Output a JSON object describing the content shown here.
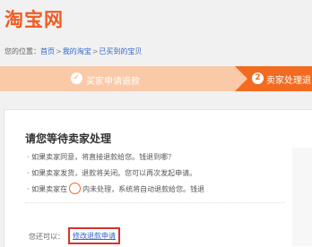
{
  "logo": "淘宝网",
  "breadcrumb": {
    "prefix": "您的位置：",
    "items": [
      "首页",
      "我的淘宝",
      "已买到的宝贝"
    ],
    "sep": ">"
  },
  "steps": {
    "step1_label": "买家申请退款",
    "step2_num": "2",
    "step2_label": "卖家处理退"
  },
  "content": {
    "title": "请您等待卖家处理",
    "line1": "· 如果卖家同意，将直接退款给您。钱退到哪？",
    "line2": "· 如果卖家发货，退款将关闭。您可以再次发起申请。",
    "line3_a": "· 如果卖家在",
    "line3_timer": "",
    "line3_b": "内未处理，系统将自动退款给您。钱退",
    "also": "您还可以：",
    "modify": "修改退款申请"
  }
}
